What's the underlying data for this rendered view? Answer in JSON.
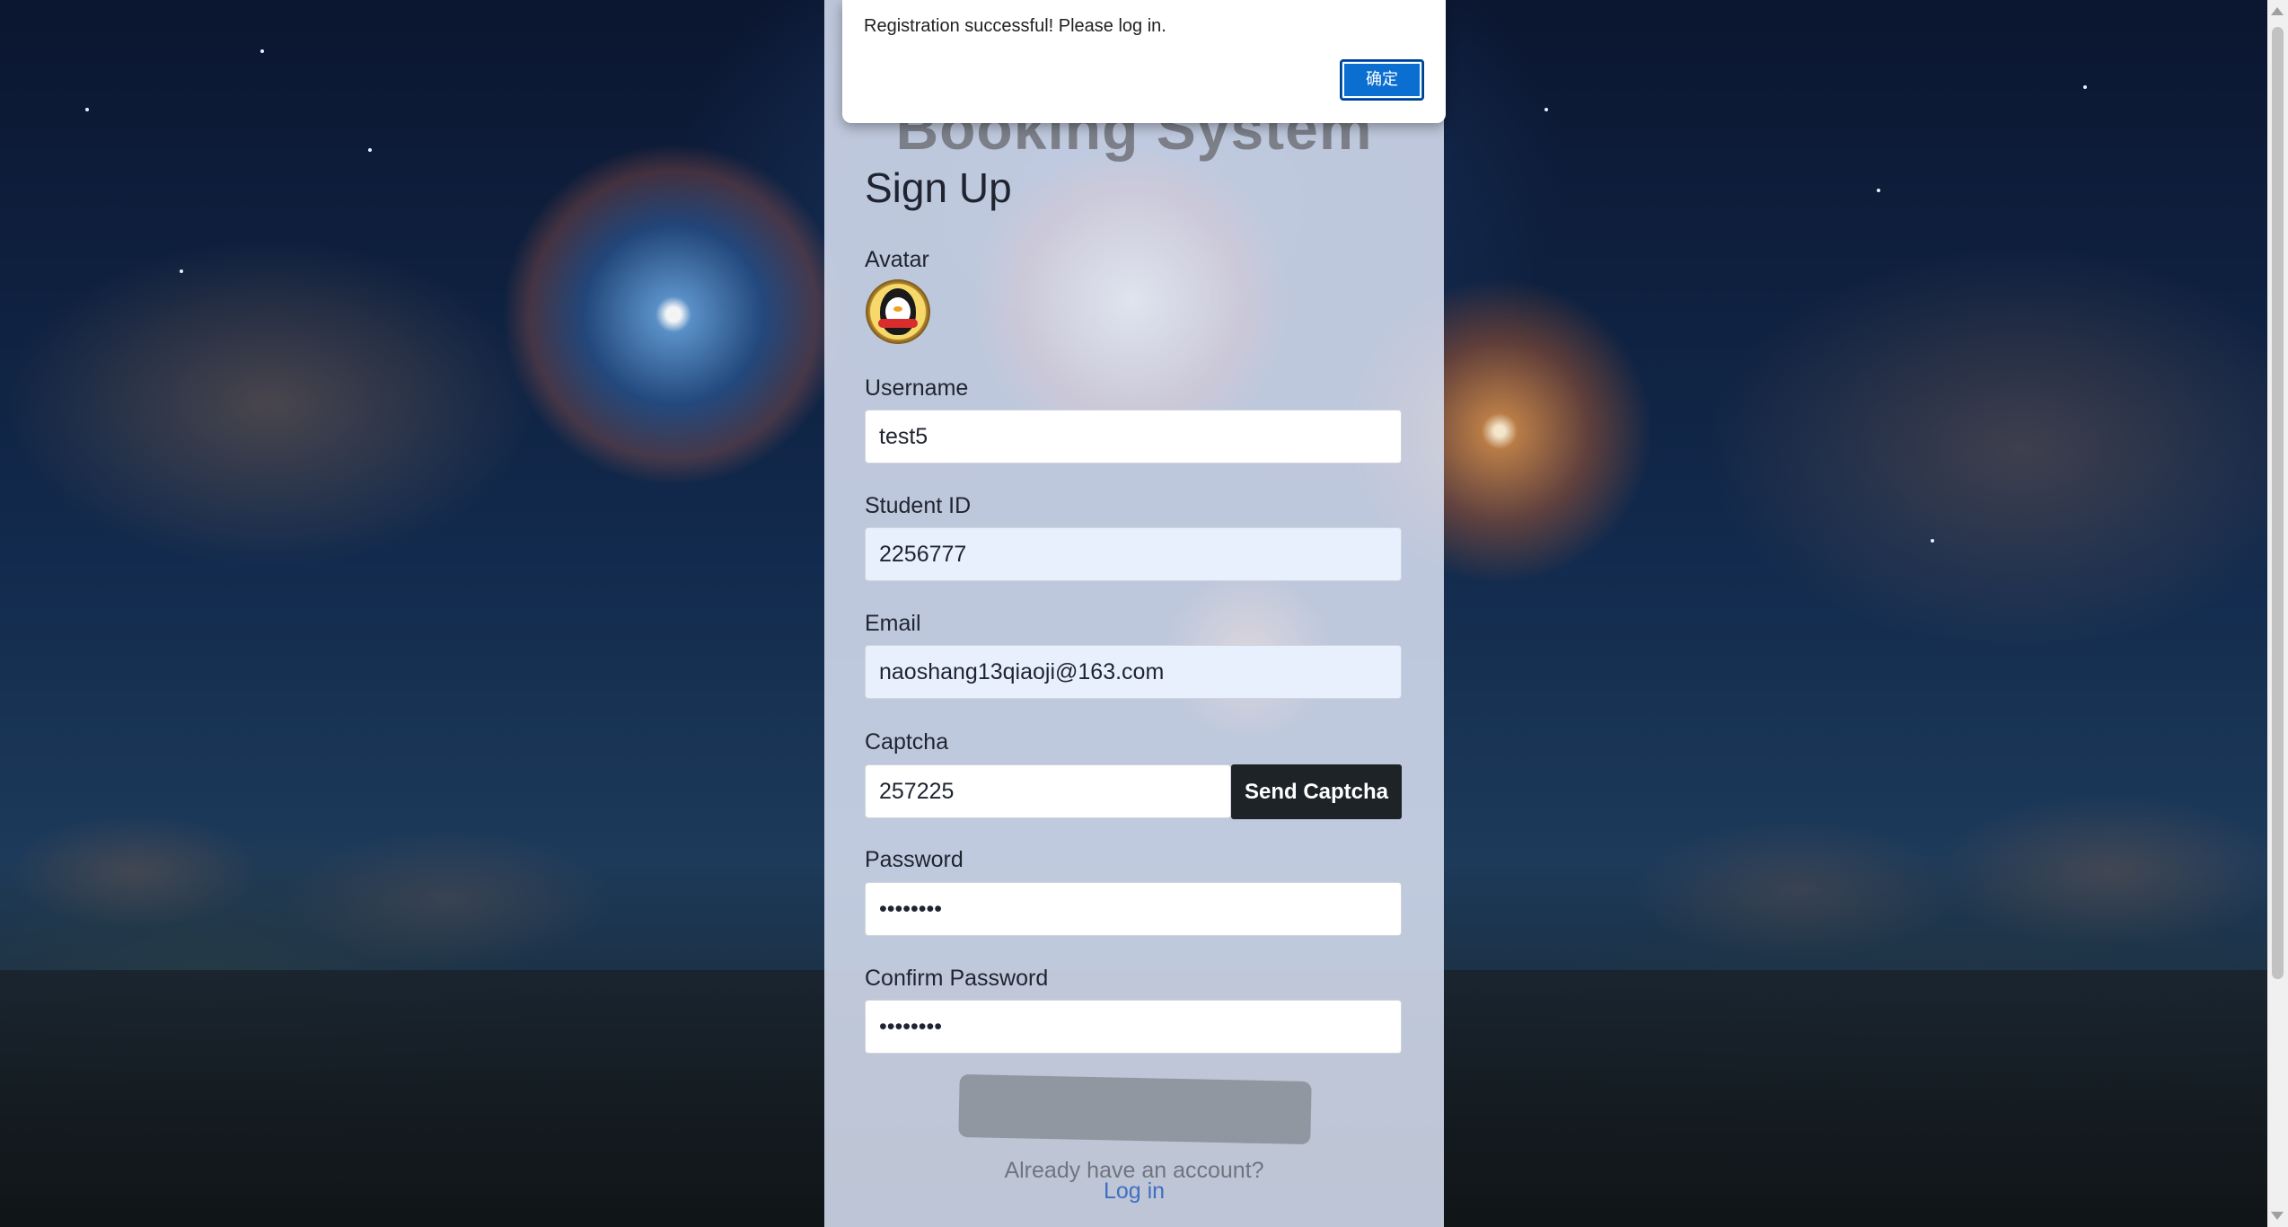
{
  "app": {
    "title": "Booking System"
  },
  "form": {
    "heading": "Sign Up",
    "avatar_label": "Avatar",
    "username_label": "Username",
    "username_value": "test5",
    "student_id_label": "Student ID",
    "student_id_value": "2256777",
    "email_label": "Email",
    "email_value": "naoshang13qiaoji@163.com",
    "captcha_label": "Captcha",
    "captcha_value": "257225",
    "send_captcha_label": "Send Captcha",
    "password_label": "Password",
    "password_value": "••••••••",
    "confirm_password_label": "Confirm Password",
    "confirm_password_value": "••••••••",
    "have_account_text": "Already have an account?",
    "login_link": "Log in"
  },
  "dialog": {
    "message": "Registration successful! Please log in.",
    "ok_label": "确定"
  },
  "colors": {
    "dialog_button": "#0a6fd0",
    "send_button": "#1e2327",
    "link": "#3f6fc0"
  }
}
